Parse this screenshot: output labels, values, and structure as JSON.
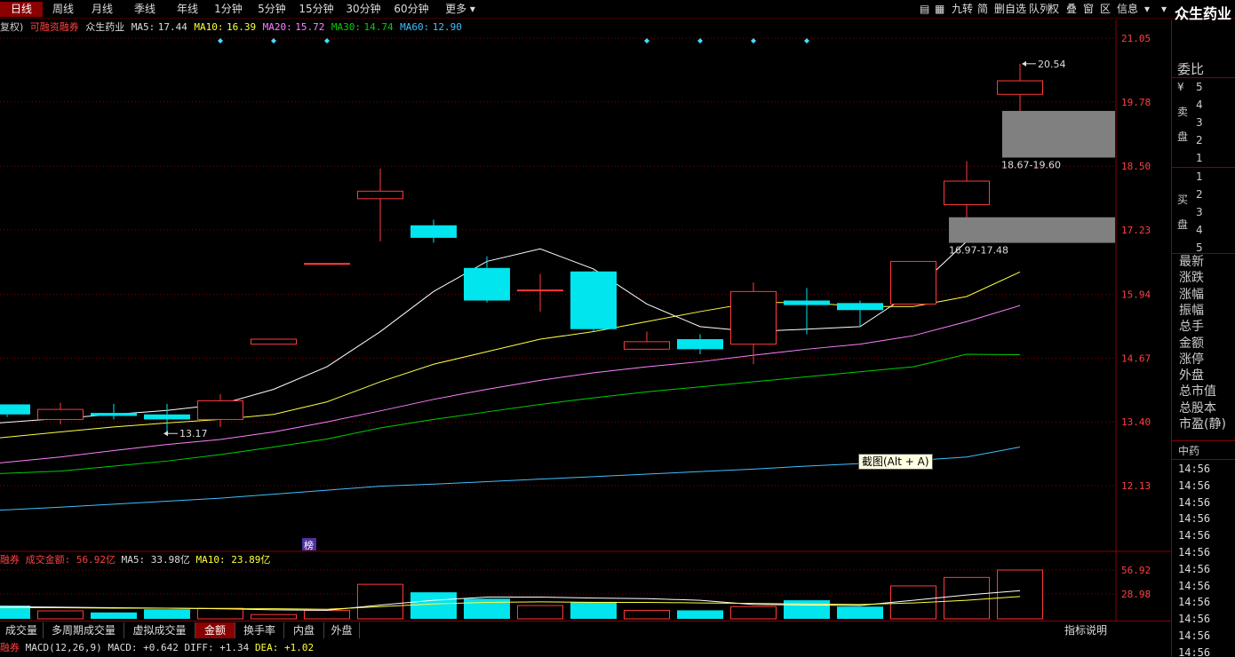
{
  "period_tabs": [
    "日线",
    "周线",
    "月线",
    "季线",
    "年线",
    "1分钟",
    "5分钟",
    "15分钟",
    "30分钟",
    "60分钟",
    "更多 ▾"
  ],
  "active_period": 0,
  "toolbar_icons": [
    "▤",
    "▦",
    "九转",
    "简",
    "删自选",
    "队列",
    "权",
    "叠",
    "窗",
    "区",
    "信息",
    "▾",
    "▾"
  ],
  "stock_name": "众生药业",
  "info": {
    "rights": "复权)",
    "margin": "可融资融券",
    "name": "众生药业",
    "ma5_label": "MA5:",
    "ma5": "17.44",
    "ma10_label": "MA10:",
    "ma10": "16.39",
    "ma20_label": "MA20:",
    "ma20": "15.72",
    "ma30_label": "MA30:",
    "ma30": "14.74",
    "ma60_label": "MA60:",
    "ma60": "12.90"
  },
  "price_axis": [
    "21.05",
    "19.78",
    "18.50",
    "17.23",
    "15.94",
    "14.67",
    "13.40",
    "12.13"
  ],
  "annotations": {
    "high": "20.54",
    "low": "13.17",
    "zone_upper": "18.67-19.60",
    "zone_lower": "16.97-17.48",
    "list_tag": "榜"
  },
  "tooltip": "截图(Alt + A)",
  "volume_info": {
    "prefix": "融券",
    "label": "成交金额:",
    "value": "56.92亿",
    "ma5": "MA5: 33.98亿",
    "ma10": "MA10: 23.89亿"
  },
  "volume_axis": [
    "56.92",
    "28.98"
  ],
  "bottom_tabs": [
    "成交量",
    "多周期成交量",
    "虚拟成交量",
    "金额",
    "换手率",
    "内盘",
    "外盘"
  ],
  "active_bottom_tab": 3,
  "help_label": "指标说明",
  "macd": {
    "prefix": "融券",
    "name": "MACD(12,26,9)",
    "macd": "MACD: +0.642",
    "diff": "DIFF: +1.34",
    "dea": "DEA: +1.02"
  },
  "right_panel": {
    "weibi": "委比",
    "yen": "¥",
    "sell_chars": [
      "卖",
      "盘"
    ],
    "sell_levels": [
      "5",
      "4",
      "3",
      "2",
      "1"
    ],
    "buy_chars": [
      "买",
      "盘"
    ],
    "buy_levels": [
      "1",
      "2",
      "3",
      "4",
      "5"
    ],
    "stats": [
      "最新",
      "涨跌",
      "涨幅",
      "振幅",
      "总手",
      "金额",
      "涨停",
      "外盘",
      "总市值",
      "总股本",
      "市盈(静)"
    ],
    "industry": "中药",
    "times": [
      "14:56",
      "14:56",
      "14:56",
      "14:56",
      "14:56",
      "14:56",
      "14:56",
      "14:56",
      "14:56",
      "14:56",
      "14:56",
      "14:56"
    ]
  },
  "colors": {
    "up": "#ff3b3b",
    "down": "#00e5ee",
    "ma5": "#ffffff",
    "ma10": "#ffff40",
    "ma20": "#ff80ff",
    "ma30": "#00d000",
    "ma60": "#40c0ff",
    "grid": "#8b0000"
  },
  "chart_data": {
    "type": "candlestick",
    "ylim": [
      11.0,
      21.7
    ],
    "candles": [
      {
        "o": 13.55,
        "c": 13.75,
        "h": 13.75,
        "l": 13.5,
        "dir": "down"
      },
      {
        "o": 13.45,
        "c": 13.65,
        "h": 13.78,
        "l": 13.35,
        "dir": "up"
      },
      {
        "o": 13.58,
        "c": 13.52,
        "h": 13.76,
        "l": 13.45,
        "dir": "down"
      },
      {
        "o": 13.55,
        "c": 13.45,
        "h": 13.76,
        "l": 13.2,
        "dir": "down"
      },
      {
        "o": 13.45,
        "c": 13.82,
        "h": 13.95,
        "l": 13.3,
        "dir": "up"
      },
      {
        "o": 14.95,
        "c": 15.05,
        "h": 15.05,
        "l": 14.95,
        "dir": "up"
      },
      {
        "o": 16.55,
        "c": 16.56,
        "h": 16.56,
        "l": 16.55,
        "dir": "up"
      },
      {
        "o": 17.85,
        "c": 18.0,
        "h": 18.45,
        "l": 17.0,
        "dir": "up"
      },
      {
        "o": 17.32,
        "c": 17.07,
        "h": 17.43,
        "l": 16.97,
        "dir": "down"
      },
      {
        "o": 16.47,
        "c": 15.82,
        "h": 16.7,
        "l": 15.78,
        "dir": "down"
      },
      {
        "o": 16.03,
        "c": 16.03,
        "h": 16.35,
        "l": 15.6,
        "dir": "up"
      },
      {
        "o": 16.4,
        "c": 15.25,
        "h": 16.42,
        "l": 15.2,
        "dir": "down"
      },
      {
        "o": 14.85,
        "c": 15.0,
        "h": 15.2,
        "l": 14.85,
        "dir": "up"
      },
      {
        "o": 15.05,
        "c": 14.85,
        "h": 15.15,
        "l": 14.75,
        "dir": "down"
      },
      {
        "o": 14.95,
        "c": 16.0,
        "h": 16.18,
        "l": 14.55,
        "dir": "up"
      },
      {
        "o": 15.82,
        "c": 15.73,
        "h": 16.07,
        "l": 15.15,
        "dir": "down"
      },
      {
        "o": 15.77,
        "c": 15.63,
        "h": 15.82,
        "l": 15.3,
        "dir": "down"
      },
      {
        "o": 16.6,
        "c": 15.75,
        "h": 16.6,
        "l": 15.75,
        "dir": "up"
      },
      {
        "o": 17.73,
        "c": 18.2,
        "h": 18.6,
        "l": 17.0,
        "dir": "up"
      },
      {
        "o": 19.93,
        "c": 20.2,
        "h": 20.54,
        "l": 19.3,
        "dir": "up"
      }
    ],
    "ma5": [
      13.38,
      13.47,
      13.55,
      13.63,
      13.75,
      14.05,
      14.5,
      15.2,
      16.0,
      16.6,
      16.85,
      16.45,
      15.75,
      15.3,
      15.2,
      15.25,
      15.3,
      16.0,
      17.0,
      17.44
    ],
    "ma10": [
      13.08,
      13.2,
      13.3,
      13.38,
      13.45,
      13.55,
      13.8,
      14.2,
      14.55,
      14.8,
      15.05,
      15.2,
      15.4,
      15.6,
      15.78,
      15.78,
      15.7,
      15.7,
      15.9,
      16.39
    ],
    "ma20": [
      12.58,
      12.7,
      12.83,
      12.95,
      13.05,
      13.2,
      13.4,
      13.62,
      13.85,
      14.05,
      14.23,
      14.38,
      14.5,
      14.6,
      14.73,
      14.85,
      14.95,
      15.12,
      15.4,
      15.72
    ],
    "ma30": [
      12.37,
      12.42,
      12.52,
      12.62,
      12.75,
      12.9,
      13.06,
      13.28,
      13.45,
      13.6,
      13.75,
      13.88,
      14.0,
      14.1,
      14.2,
      14.3,
      14.4,
      14.5,
      14.75,
      14.74
    ],
    "ma60": [
      11.64,
      11.7,
      11.76,
      11.82,
      11.88,
      11.96,
      12.04,
      12.12,
      12.16,
      12.21,
      12.26,
      12.31,
      12.36,
      12.41,
      12.46,
      12.52,
      12.57,
      12.63,
      12.7,
      12.9
    ],
    "volumes": [
      2.5,
      1.5,
      1.2,
      1.8,
      2.0,
      0.8,
      1.6,
      6.5,
      5.0,
      3.8,
      2.5,
      3.2,
      1.6,
      1.6,
      2.3,
      3.5,
      2.3,
      6.2,
      7.8,
      9.2
    ],
    "vol_ma5": [
      2.3,
      2.2,
      2.1,
      2.0,
      1.9,
      1.7,
      1.6,
      2.6,
      3.5,
      4.1,
      4.1,
      3.9,
      3.8,
      3.5,
      2.7,
      2.6,
      2.5,
      3.5,
      4.5,
      5.3
    ],
    "vol_ma10": [
      2.1,
      2.1,
      2.0,
      2.0,
      1.9,
      1.9,
      1.8,
      2.3,
      2.8,
      3.1,
      3.2,
      3.1,
      3.1,
      3.0,
      2.9,
      2.8,
      2.7,
      3.0,
      3.5,
      4.2
    ],
    "signal_days": [
      4,
      5,
      6,
      12,
      13,
      14,
      15
    ]
  }
}
